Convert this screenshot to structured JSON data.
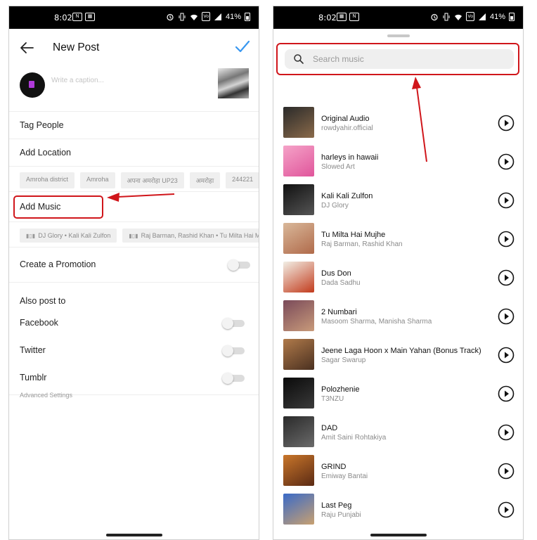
{
  "colors": {
    "accent": "#3897f0",
    "annotation": "#d0161b"
  },
  "left": {
    "status": {
      "time": "8:02",
      "battery": "41%",
      "sicons": [
        "▦",
        "N"
      ]
    },
    "header": {
      "title": "New Post"
    },
    "caption": {
      "placeholder": "Write a caption..."
    },
    "rows": {
      "tag_people": "Tag People",
      "add_location": "Add Location",
      "add_music": "Add Music",
      "create_promotion": "Create a Promotion"
    },
    "location_chips": [
      "Amroha district",
      "Amroha",
      "अपना अमरोहा UP23",
      "अमरोहा",
      "244221"
    ],
    "music_chips": [
      "DJ Glory • Kali Kali Zulfon",
      "Raj Barman, Rashid Khan • Tu Milta Hai Mu"
    ],
    "also_post": {
      "title": "Also post to",
      "facebook": "Facebook",
      "twitter": "Twitter",
      "tumblr": "Tumblr"
    },
    "advanced": "Advanced Settings"
  },
  "right": {
    "status": {
      "time": "8:02",
      "battery": "41%",
      "sicons": [
        "▦",
        "N"
      ]
    },
    "search": {
      "placeholder": "Search music"
    },
    "tracks": [
      {
        "name": "Original Audio",
        "artist": "rowdyahir.official",
        "cover_colors": [
          "#2a2a2a",
          "#8a6a4a"
        ]
      },
      {
        "name": "harleys in hawaii",
        "artist": "Slowed Art",
        "cover_colors": [
          "#f5a3c8",
          "#e0559b"
        ]
      },
      {
        "name": "Kali Kali Zulfon",
        "artist": "DJ Glory",
        "cover_colors": [
          "#111111",
          "#555555"
        ]
      },
      {
        "name": "Tu Milta Hai Mujhe",
        "artist": "Raj Barman, Rashid Khan",
        "cover_colors": [
          "#d9b89a",
          "#b06a4a"
        ]
      },
      {
        "name": "Dus Don",
        "artist": "Dada Sadhu",
        "cover_colors": [
          "#f2efe6",
          "#c23b1c"
        ]
      },
      {
        "name": "2 Numbari",
        "artist": "Masoom Sharma, Manisha Sharma",
        "cover_colors": [
          "#7a4a5a",
          "#c89a7a"
        ]
      },
      {
        "name": "Jeene Laga Hoon x Main Yahan (Bonus Track)",
        "artist": "Sagar Swarup",
        "cover_colors": [
          "#b07a4a",
          "#4a3020"
        ]
      },
      {
        "name": "Polozhenie",
        "artist": "T3NZU",
        "cover_colors": [
          "#0a0a0a",
          "#3a3a3a"
        ]
      },
      {
        "name": "DAD",
        "artist": "Amit Saini Rohtakiya",
        "cover_colors": [
          "#2a2a2a",
          "#6a6a6a"
        ]
      },
      {
        "name": "GRIND",
        "artist": "Emiway Bantai",
        "cover_colors": [
          "#c9762a",
          "#5a2a14"
        ]
      },
      {
        "name": "Last Peg",
        "artist": "Raju Punjabi",
        "cover_colors": [
          "#3a6ac8",
          "#c8a070"
        ]
      }
    ]
  }
}
